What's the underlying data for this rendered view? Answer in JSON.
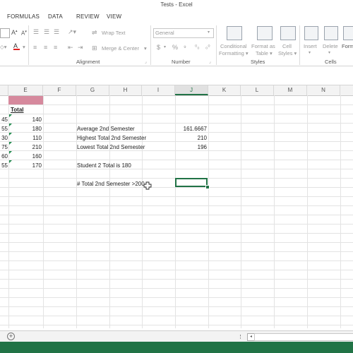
{
  "window": {
    "title": "Tests - Excel"
  },
  "tabs": [
    "FORMULAS",
    "DATA",
    "REVIEW",
    "VIEW"
  ],
  "ribbon": {
    "alignment": {
      "wrap_text": "Wrap Text",
      "merge_center": "Merge & Center",
      "label": "Alignment"
    },
    "number": {
      "format": "General",
      "currency": "$",
      "percent": "%",
      "comma": "»",
      "label": "Number"
    },
    "styles": {
      "conditional": [
        "Conditional",
        "Formatting ▾"
      ],
      "format_as_table": [
        "Format as",
        "Table ▾"
      ],
      "cell_styles": [
        "Cell",
        "Styles ▾"
      ],
      "label": "Styles"
    },
    "cells": {
      "insert": "Insert",
      "delete": "Delete",
      "format": "Form",
      "label": "Cells"
    }
  },
  "grid": {
    "columns": [
      "E",
      "F",
      "G",
      "H",
      "I",
      "J",
      "K",
      "L",
      "M",
      "N"
    ],
    "selected_column": "J",
    "col_d_values": [
      "45",
      "55",
      "30",
      "75",
      "60",
      "55"
    ],
    "col_e_header": "Total",
    "col_e_values": [
      "140",
      "180",
      "110",
      "210",
      "160",
      "170"
    ],
    "labels": {
      "average": "Average 2nd Semester",
      "highest": "Highest Total 2nd Semester",
      "lowest": "Lowest Total 2nd Semester",
      "student": "Student 2 Total is 180",
      "count": "# Total 2nd Semester >200"
    },
    "results": {
      "average": "161.6667",
      "highest": "210",
      "lowest": "196"
    }
  },
  "sheetbar": {
    "add_sheet": "+"
  },
  "colors": {
    "accent": "#217346",
    "header_fill": "#d6899d"
  }
}
